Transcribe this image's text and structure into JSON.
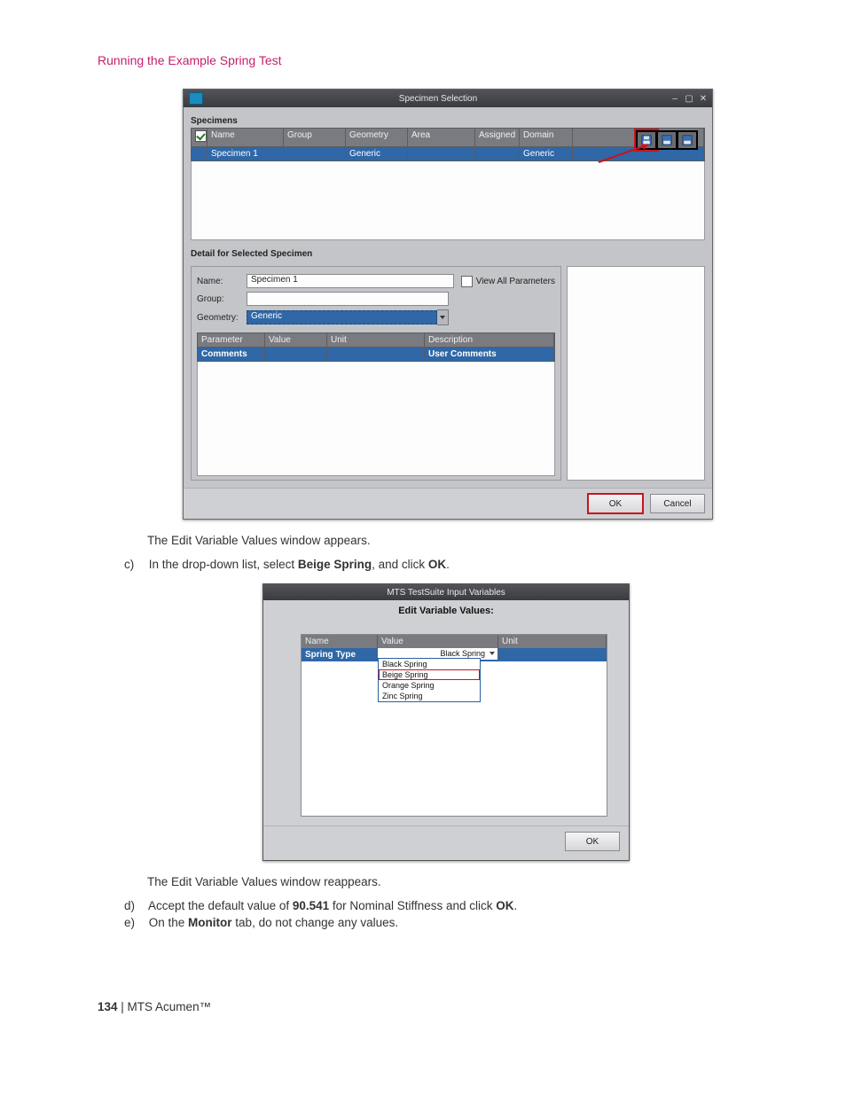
{
  "page": {
    "header": "Running the Example Spring Test",
    "text_after_win1": "The Edit Variable Values window appears.",
    "step_c_prefix": "c)",
    "step_c_text_1": "In the drop-down list, select ",
    "step_c_bold_1": "Beige Spring",
    "step_c_text_2": ", and click ",
    "step_c_bold_2": "OK",
    "step_c_text_3": ".",
    "text_after_win2": "The Edit Variable Values window reappears.",
    "step_d_prefix": "d)",
    "step_d_text_1": "Accept the default value of ",
    "step_d_bold_1": "90.541",
    "step_d_text_2": " for Nominal Stiffness and click ",
    "step_d_bold_2": "OK",
    "step_d_text_3": ".",
    "step_e_prefix": "e)",
    "step_e_text_1": "On the ",
    "step_e_bold_1": "Monitor",
    "step_e_text_2": " tab, do not change any values.",
    "footer_page": "134",
    "footer_sep": " | ",
    "footer_product": "MTS Acumen",
    "footer_tm": "™"
  },
  "win1": {
    "title": "Specimen Selection",
    "section_specimens": "Specimens",
    "cols": {
      "name": "Name",
      "group": "Group",
      "geometry": "Geometry",
      "area": "Area",
      "assigned": "Assigned",
      "domain": "Domain"
    },
    "row1": {
      "name": "Specimen 1",
      "group": "",
      "geometry": "Generic",
      "area": "",
      "assigned": "",
      "domain": "Generic"
    },
    "section_detail": "Detail for Selected Specimen",
    "detail": {
      "name_label": "Name:",
      "name_value": "Specimen 1",
      "group_label": "Group:",
      "geometry_label": "Geometry:",
      "geometry_value": "Generic",
      "view_all": "View All Parameters"
    },
    "param_cols": {
      "parameter": "Parameter",
      "value": "Value",
      "unit": "Unit",
      "description": "Description"
    },
    "param_row": {
      "parameter": "Comments",
      "value": "",
      "unit": "",
      "description": "User Comments"
    },
    "buttons": {
      "ok": "OK",
      "cancel": "Cancel"
    }
  },
  "win2": {
    "title": "MTS TestSuite Input Variables",
    "header": "Edit Variable Values:",
    "cols": {
      "name": "Name",
      "value": "Value",
      "unit": "Unit"
    },
    "row": {
      "name": "Spring Type",
      "value": "Black Spring"
    },
    "options": {
      "o1": "Black Spring",
      "o2": "Beige Spring",
      "o3": "Orange Spring",
      "o4": "Zinc Spring"
    },
    "buttons": {
      "ok": "OK"
    }
  }
}
